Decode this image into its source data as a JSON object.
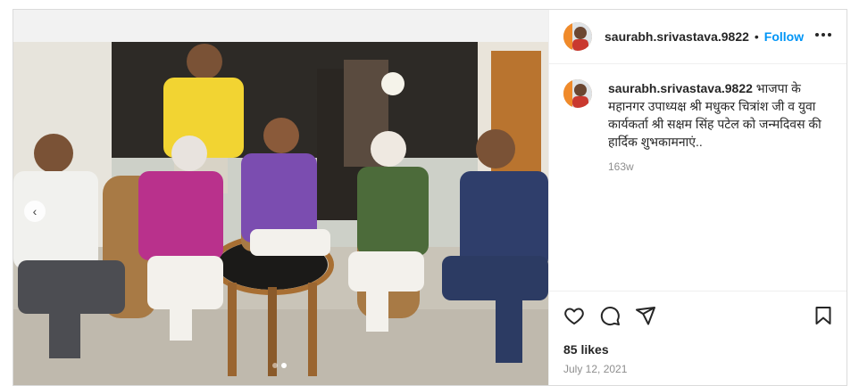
{
  "post": {
    "username": "saurabh.srivastava.9822",
    "follow_label": "Follow",
    "separator": "•",
    "caption_text": "भाजपा के महानगर उपाध्यक्ष श्री मधुकर चित्रांश जी व युवा कार्यकर्ता श्री सक्षम सिंह पटेल को जन्मदिवस की हार्दिक शुभकामनाएं..",
    "caption_age": "163w",
    "likes": "85 likes",
    "date": "July 12, 2021"
  },
  "carousel": {
    "total": 2,
    "current": 2
  },
  "icons": {
    "avatar": "avatar-image",
    "prev": "chevron-left-icon",
    "more": "more-options-icon",
    "like": "heart-icon",
    "comment": "comment-icon",
    "share": "paper-plane-icon",
    "save": "bookmark-icon"
  }
}
